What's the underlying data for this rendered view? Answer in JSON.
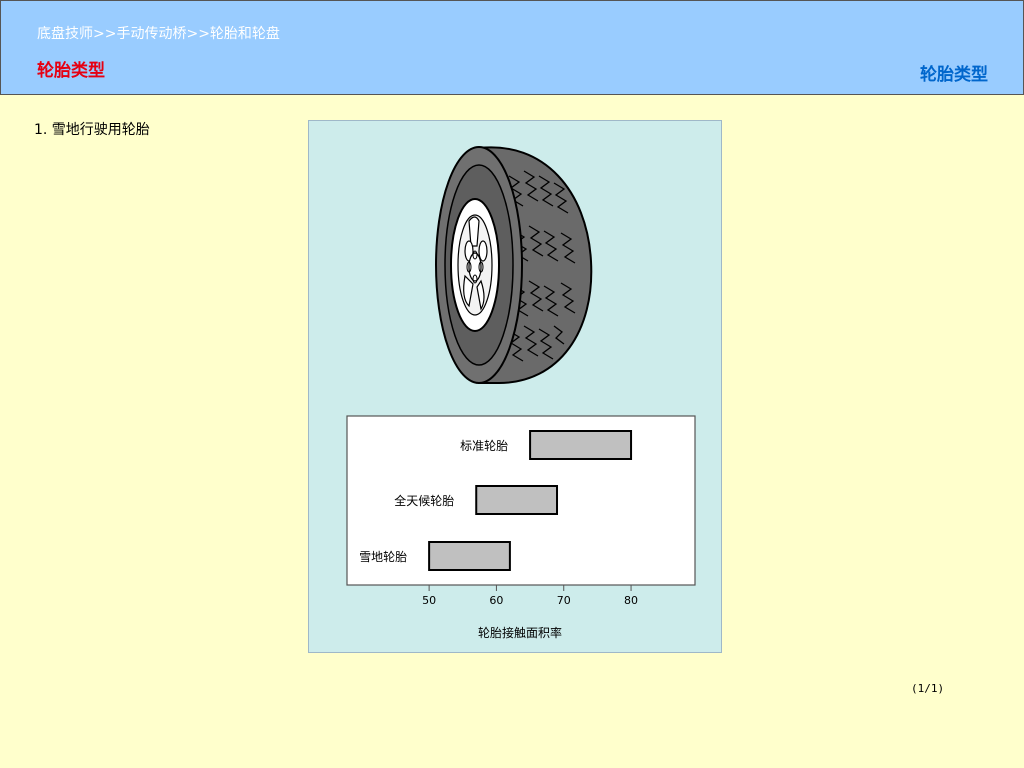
{
  "header": {
    "breadcrumb": "底盘技师>>手动传动桥>>轮胎和轮盘",
    "section_title": "轮胎类型",
    "right_title": "轮胎类型"
  },
  "content": {
    "item_label": "1.  雪地行驶用轮胎",
    "page_indicator": "(1/1)"
  },
  "icons": {
    "tire": "tire-illustration-icon"
  },
  "colors": {
    "header_bg": "#99ccff",
    "page_bg": "#ffffcc",
    "figure_bg": "#cdeceb",
    "section_title": "#e60012",
    "right_title": "#0066cc",
    "bar_fill": "#c0c0c0"
  },
  "chart_data": {
    "type": "bar",
    "orientation": "horizontal",
    "categories": [
      "标准轮胎",
      "全天候轮胎",
      "雪地轮胎"
    ],
    "ranges": [
      [
        65,
        80
      ],
      [
        57,
        69
      ],
      [
        50,
        62
      ]
    ],
    "xticks": [
      50,
      60,
      70,
      80
    ],
    "xlabel": "轮胎接触面积率",
    "xlim": [
      37.8,
      89.5
    ]
  }
}
